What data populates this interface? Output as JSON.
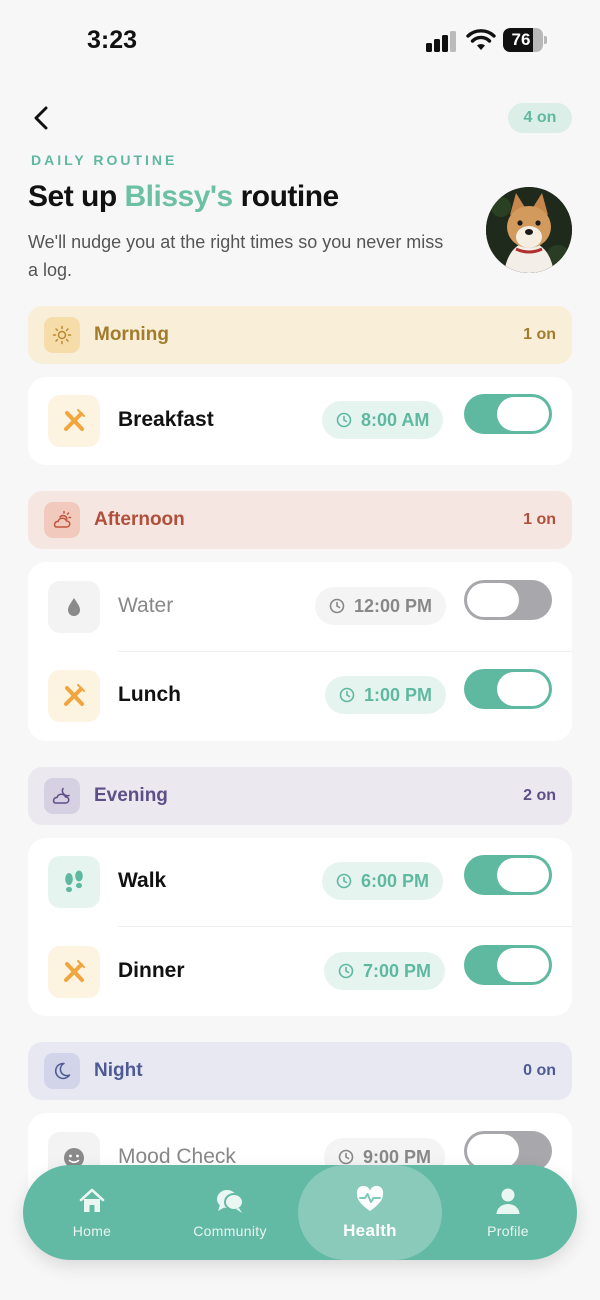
{
  "status_bar": {
    "time": "3:23",
    "battery": "76",
    "battery_level": 0.76
  },
  "header": {
    "enabled_count": "4 on",
    "eyebrow": "DAILY ROUTINE",
    "title_prefix": "Set up ",
    "pet_name": "Blissy's",
    "title_suffix": " routine",
    "subtitle": "We'll nudge you at the right times so you never miss a log."
  },
  "sections": {
    "morning": {
      "name": "Morning",
      "count": "1 on",
      "items": [
        {
          "label": "Breakfast",
          "time": "8:00 AM",
          "enabled": true,
          "icon": "fork-knife-icon"
        }
      ]
    },
    "afternoon": {
      "name": "Afternoon",
      "count": "1 on",
      "items": [
        {
          "label": "Water",
          "time": "12:00 PM",
          "enabled": false,
          "icon": "water-drop-icon"
        },
        {
          "label": "Lunch",
          "time": "1:00 PM",
          "enabled": true,
          "icon": "fork-knife-icon"
        }
      ]
    },
    "evening": {
      "name": "Evening",
      "count": "2 on",
      "items": [
        {
          "label": "Walk",
          "time": "6:00 PM",
          "enabled": true,
          "icon": "paw-prints-icon"
        },
        {
          "label": "Dinner",
          "time": "7:00 PM",
          "enabled": true,
          "icon": "fork-knife-icon"
        }
      ]
    },
    "night": {
      "name": "Night",
      "count": "0 on",
      "items": [
        {
          "label": "Mood Check",
          "time": "9:00 PM",
          "enabled": false,
          "icon": "smiley-icon"
        }
      ]
    }
  },
  "nav": {
    "items": [
      {
        "label": "Home",
        "icon": "home-icon"
      },
      {
        "label": "Community",
        "icon": "chat-bubbles-icon"
      },
      {
        "label": "Health",
        "icon": "heart-pulse-icon"
      },
      {
        "label": "Profile",
        "icon": "person-icon"
      }
    ],
    "active": "Health"
  },
  "colors": {
    "accent": "#5fb8a0",
    "morning_bg": "#f9efd9",
    "morning_text": "#a27b2c",
    "afternoon_bg": "#f6e6e1",
    "afternoon_text": "#b0503c",
    "evening_bg": "#ebe8f0",
    "evening_text": "#5e4f86",
    "night_bg": "#e8e8f3",
    "night_text": "#4e5a92",
    "toggle_off": "#a8a8ac"
  }
}
